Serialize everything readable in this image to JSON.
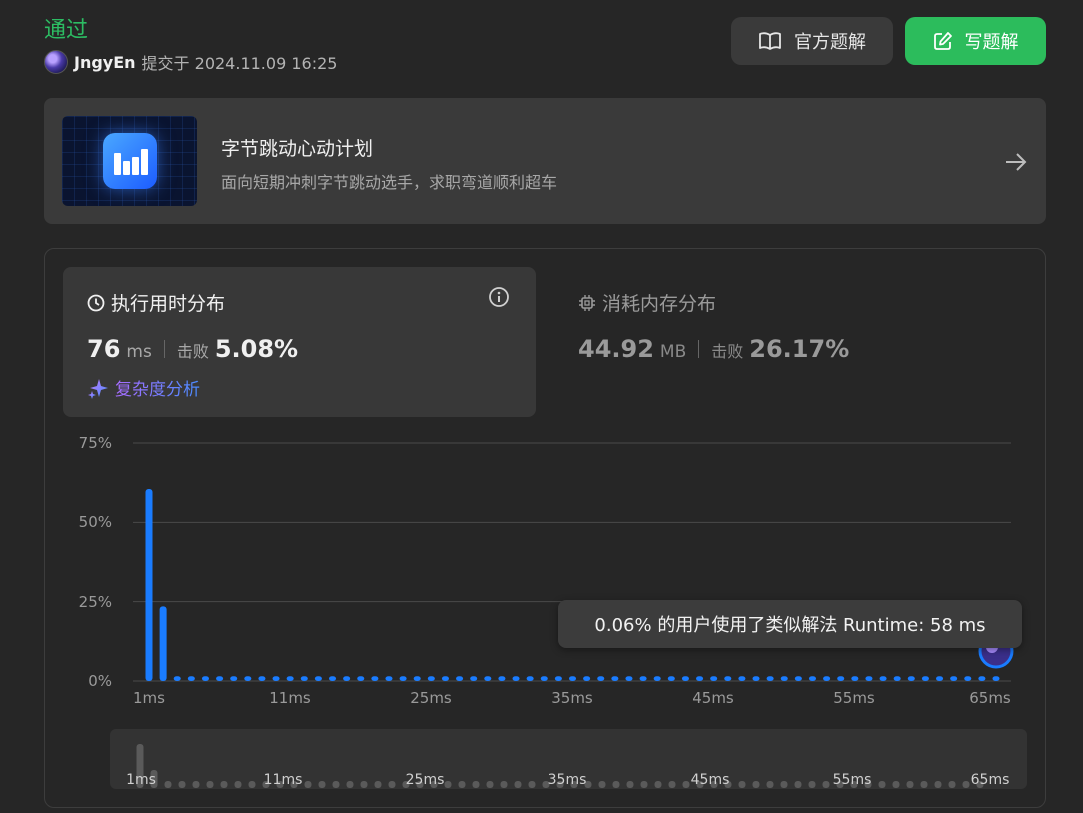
{
  "header": {
    "status": "通过",
    "username": "JngyEn",
    "submitted_text": "提交于 2024.11.09 16:25",
    "official_solution_label": "官方题解",
    "write_solution_label": "写题解"
  },
  "promo": {
    "title": "字节跳动心动计划",
    "description": "面向短期冲刺字节跳动选手，求职弯道顺利超车"
  },
  "runtime": {
    "title": "执行用时分布",
    "value": "76",
    "unit": "ms",
    "beat_label": "击败",
    "beat_pct": "5.08%",
    "analysis_label": "复杂度分析"
  },
  "memory": {
    "title": "消耗内存分布",
    "value": "44.92",
    "unit": "MB",
    "beat_label": "击败",
    "beat_pct": "26.17%"
  },
  "tooltip": "0.06% 的用户使用了类似解法 Runtime: 58 ms",
  "colors": {
    "accent_green": "#2cbc5c",
    "bar_blue": "#1a7cff",
    "mini_bar": "#5a5a5a"
  },
  "chart_data": {
    "type": "bar",
    "x": [
      1,
      3,
      5,
      7,
      9,
      11,
      13,
      15,
      17,
      19,
      21,
      23,
      25,
      27,
      29,
      31,
      33,
      35,
      37,
      39,
      41,
      43,
      45,
      47,
      49,
      51,
      53,
      55,
      57,
      59,
      61,
      63,
      65
    ],
    "x_unit": "ms",
    "values": [
      60.5,
      23.5,
      1.5,
      1.5,
      1.5,
      1.5,
      1.5,
      1.5,
      1.5,
      1.5,
      1.5,
      1.5,
      1.5,
      1.5,
      1.5,
      1.5,
      1.5,
      1.5,
      1.5,
      1.5,
      1.5,
      1.5,
      1.5,
      1.5,
      1.5,
      1.5,
      1.5,
      1.5,
      1.5,
      1.5,
      1.5,
      1.5,
      1.5
    ],
    "bar_count": 61,
    "ylim": [
      0,
      75
    ],
    "yticks": [
      "75%",
      "50%",
      "25%",
      "0%"
    ],
    "xticks": [
      "1ms",
      "11ms",
      "25ms",
      "35ms",
      "45ms",
      "55ms",
      "65ms"
    ],
    "grid": true
  },
  "mini_chart": {
    "xticks": [
      "1ms",
      "11ms",
      "25ms",
      "35ms",
      "45ms",
      "55ms",
      "65ms"
    ]
  }
}
